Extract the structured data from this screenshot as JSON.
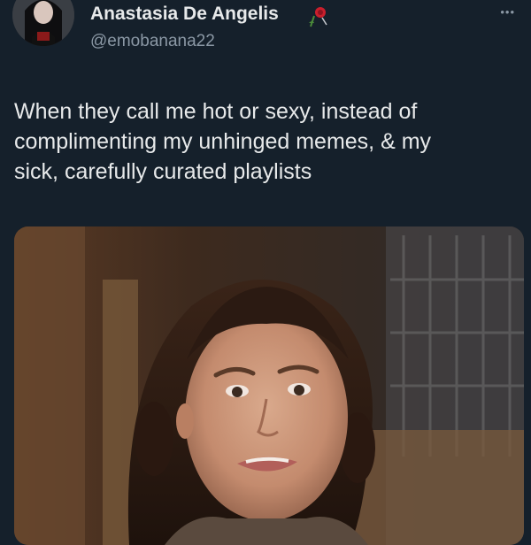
{
  "tweet": {
    "author": {
      "display_name": "Anastasia De Angelis",
      "handle": "@emobanana22",
      "avatar_icon": "avatar-portrait",
      "badge_icon": "rose-emoji-icon"
    },
    "more_icon": "•••",
    "text": "When they call me hot or sexy, instead of\ncomplimenting my unhinged memes, & my\nsick, carefully curated playlists",
    "media": {
      "type": "photo",
      "alt": ""
    }
  },
  "colors": {
    "background": "#15202b",
    "text_primary": "#e7e9ea",
    "text_secondary": "#8b98a5"
  }
}
